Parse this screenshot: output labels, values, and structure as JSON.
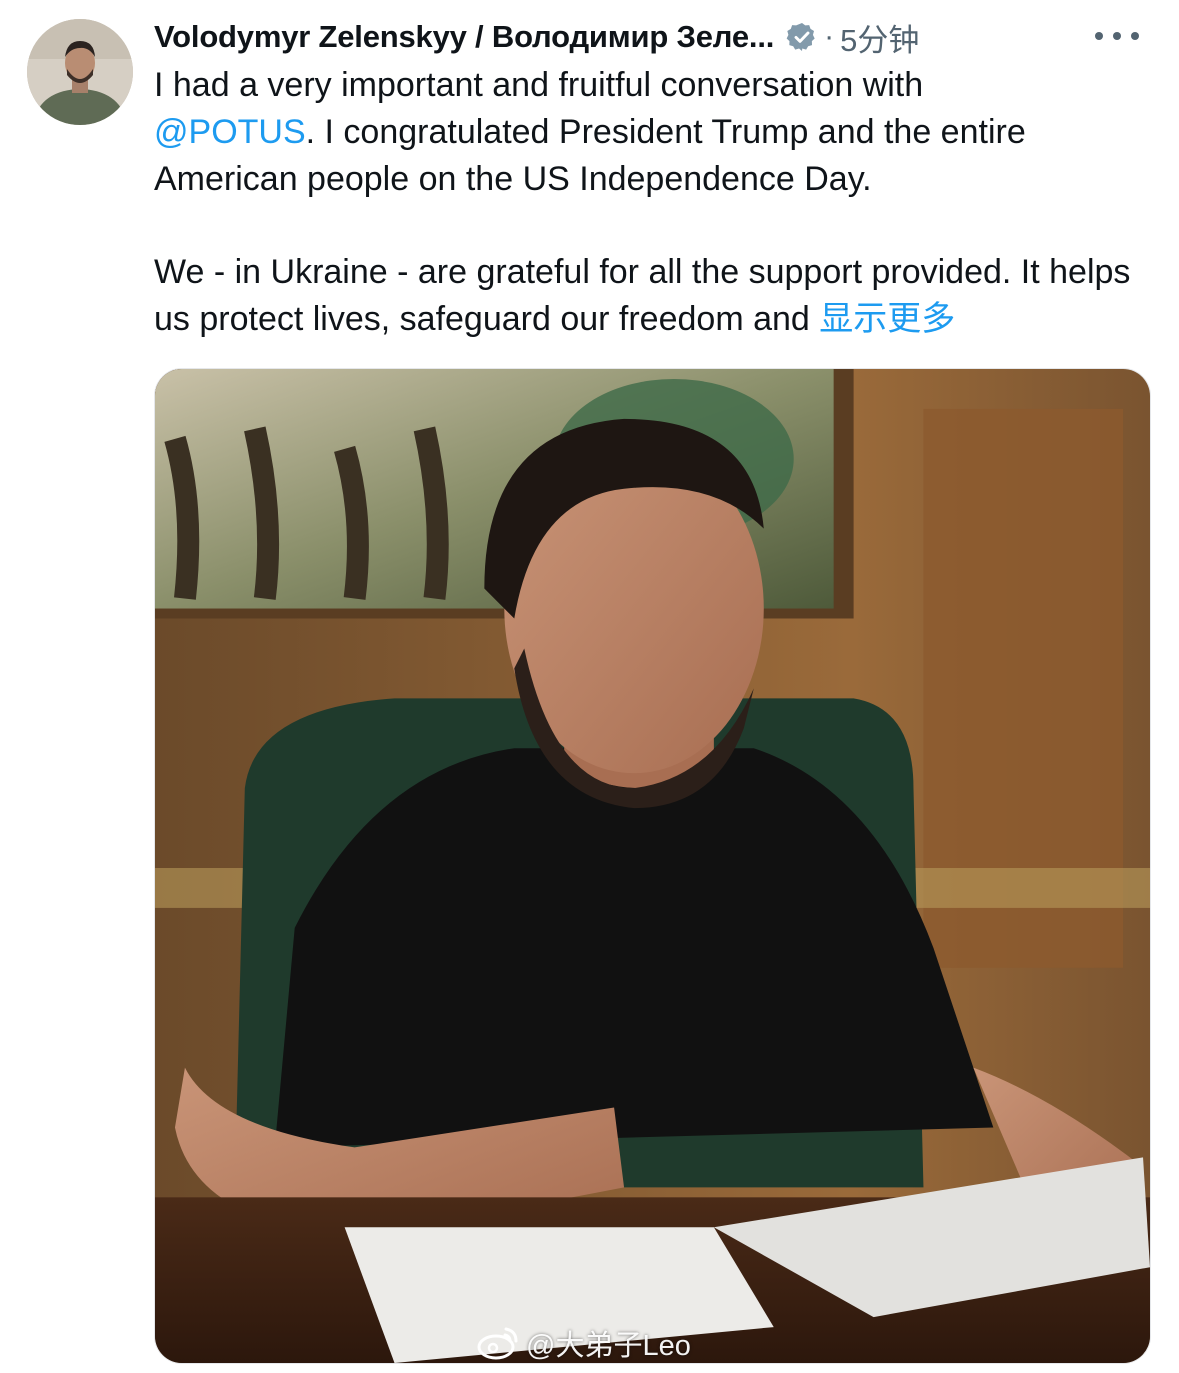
{
  "post": {
    "author_name": "Volodymyr Zelenskyy / Володимир Зеле...",
    "separator": "·",
    "time": "5分钟",
    "text_line1": "I had a very important and fruitful conversation with",
    "mention": "@POTUS",
    "text_line2_rest": ". I congratulated President Trump and the entire",
    "text_line3": "American people on the US Independence Day.",
    "text_para2": "We - in Ukraine - are grateful for all the support provided. It helps us protect lives, safeguard our freedom and",
    "show_more": "显示更多"
  },
  "watermark": {
    "text": "@大弟子Leo",
    "icon": "weibo-icon"
  },
  "colors": {
    "link": "#1d9bf0",
    "secondary_text": "#536471",
    "verified": "#829aab"
  }
}
